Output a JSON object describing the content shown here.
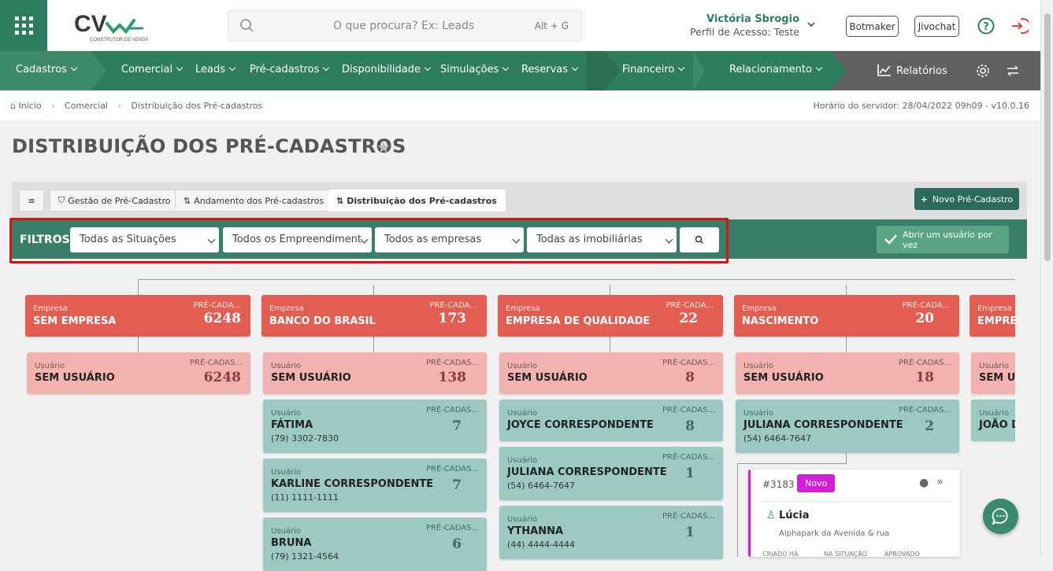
{
  "header": {
    "search_placeholder": "O que procura? Ex: Leads",
    "search_shortcut": "Alt + G",
    "user_name": "Victória Sbrogio",
    "user_profile": "Perfil de Acesso: Teste",
    "botmaker_label": "Botmaker",
    "jivochat_label": "Jivochat"
  },
  "nav": {
    "cadastros": "Cadastros",
    "comercial": "Comercial",
    "leads": "Leads",
    "pre_cadastros": "Pré-cadastros",
    "disponibilidade": "Disponibilidade",
    "simulacoes": "Simulações",
    "reservas": "Reservas",
    "financeiro": "Financeiro",
    "relacionamento": "Relacionamento",
    "relatorios": "Relatórios"
  },
  "breadcrumb": {
    "home": "Início",
    "comercial": "Comercial",
    "current": "Distribuição dos Pré-cadastros",
    "server_time": "Horário do servidor: 28/04/2022 09h09 - v10.0.16"
  },
  "page": {
    "title": "DISTRIBUIÇÃO DOS PRÉ-CADASTROS"
  },
  "tabs": {
    "gestao": "Gestão de Pré-Cadastro",
    "andamento": "Andamento dos Pré-cadastros",
    "distribuicao": "Distribuição dos Pré-cadastros",
    "novo": "Novo Pré-Cadastro"
  },
  "filters": {
    "label": "FILTROS",
    "situacoes": "Todas as Situações",
    "empreendimentos": "Todos os Empreendiment",
    "empresas": "Todos as empresas",
    "imobiliarias": "Todas as imobiliárias",
    "one_user": "Abrir um usuário por vez"
  },
  "labels": {
    "empresa": "Empresa",
    "usuario": "Usuário",
    "pre_cad_emp": "PRÉ-CADA...",
    "pre_cad_usr": "PRÉ-CADAS..."
  },
  "columns": [
    {
      "empresa": "SEM EMPRESA",
      "total": "6248",
      "users": [
        {
          "name": "SEM USUÁRIO",
          "count": "6248"
        }
      ]
    },
    {
      "empresa": "BANCO DO BRASIL",
      "total": "173",
      "users": [
        {
          "name": "SEM USUÁRIO",
          "count": "138"
        },
        {
          "name": "FÁTIMA",
          "count": "7",
          "phone": "(79) 3302-7830"
        },
        {
          "name": "KARLINE CORRESPONDENTE",
          "count": "7",
          "phone": "(11) 1111-1111"
        },
        {
          "name": "BRUNA",
          "count": "6",
          "phone": "(79) 1321-4564"
        }
      ]
    },
    {
      "empresa": "EMPRESA DE QUALIDADE",
      "total": "22",
      "users": [
        {
          "name": "SEM USUÁRIO",
          "count": "8"
        },
        {
          "name": "JOYCE CORRESPONDENTE",
          "count": "8"
        },
        {
          "name": "JULIANA CORRESPONDENTE",
          "count": "1",
          "phone": "(54) 6464-7647"
        },
        {
          "name": "YTHANNA",
          "count": "1",
          "phone": "(44) 4444-4444"
        }
      ]
    },
    {
      "empresa": "NASCIMENTO",
      "total": "20",
      "users": [
        {
          "name": "SEM USUÁRIO",
          "count": "18"
        },
        {
          "name": "JULIANA CORRESPONDENTE",
          "count": "2",
          "phone": "(54) 6464-7647"
        }
      ]
    },
    {
      "empresa": "EMPRES",
      "users": [
        {
          "name": "SEM US"
        },
        {
          "name": "JOÃO D"
        }
      ]
    }
  ],
  "lead": {
    "id": "#3183",
    "status": "Novo",
    "name": "Lúcia",
    "project": "Alphapark da Avenida & rua",
    "col1": "CRIADO HÁ",
    "col2": "NA SITUAÇÃO",
    "col3": "APROVADO",
    "status_color": "#d31fd9"
  },
  "colors": {
    "brand_green": "#2e7d5e",
    "empresa_red": "#e35d52",
    "user_teal": "#9ccac2",
    "highlight": "#e01010"
  }
}
